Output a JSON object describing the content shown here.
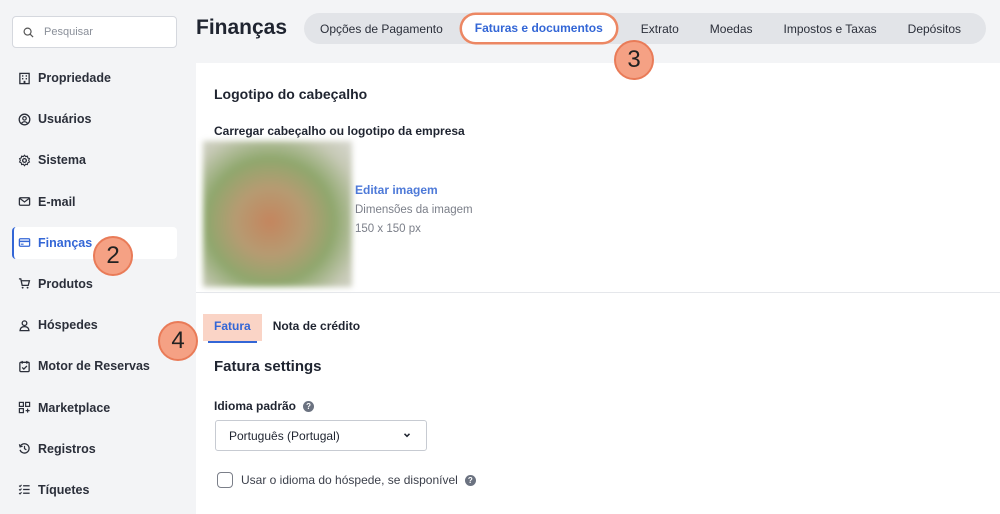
{
  "search": {
    "placeholder": "Pesquisar"
  },
  "sidebar": {
    "items": [
      {
        "label": "Propriedade",
        "icon": "building-icon"
      },
      {
        "label": "Usuários",
        "icon": "user-circle-icon"
      },
      {
        "label": "Sistema",
        "icon": "gear-icon"
      },
      {
        "label": "E-mail",
        "icon": "mail-icon"
      },
      {
        "label": "Finanças",
        "icon": "credit-card-icon",
        "active": true
      },
      {
        "label": "Produtos",
        "icon": "cart-icon"
      },
      {
        "label": "Hóspedes",
        "icon": "person-icon"
      },
      {
        "label": "Motor de Reservas",
        "icon": "calendar-check-icon"
      },
      {
        "label": "Marketplace",
        "icon": "grid-plus-icon"
      },
      {
        "label": "Registros",
        "icon": "history-icon"
      },
      {
        "label": "Tíquetes",
        "icon": "checklist-icon"
      }
    ]
  },
  "header": {
    "title": "Finanças",
    "tabs": [
      {
        "label": "Opções de Pagamento"
      },
      {
        "label": "Faturas e documentos",
        "active": true
      },
      {
        "label": "Extrato"
      },
      {
        "label": "Moedas"
      },
      {
        "label": "Impostos e Taxas"
      },
      {
        "label": "Depósitos"
      }
    ]
  },
  "badges": {
    "b2": "2",
    "b3": "3",
    "b4": "4"
  },
  "main": {
    "section_title": "Logotipo do cabeçalho",
    "upload_label": "Carregar cabeçalho ou logotipo da empresa",
    "edit_image": "Editar imagem",
    "dimensions_label": "Dimensões da imagem",
    "dimensions_value": "150 x 150 px",
    "doc_tabs": [
      {
        "label": "Fatura",
        "active": true
      },
      {
        "label": "Nota de crédito"
      }
    ],
    "settings_title": "Fatura settings",
    "language_label": "Idioma padrão",
    "language_value": "Português (Portugal)",
    "guest_language_checkbox": "Usar o idioma do hóspede, se disponível"
  },
  "colors": {
    "accent": "#3366d6",
    "badge": "#f5a184",
    "highlight": "#fad4c6"
  }
}
